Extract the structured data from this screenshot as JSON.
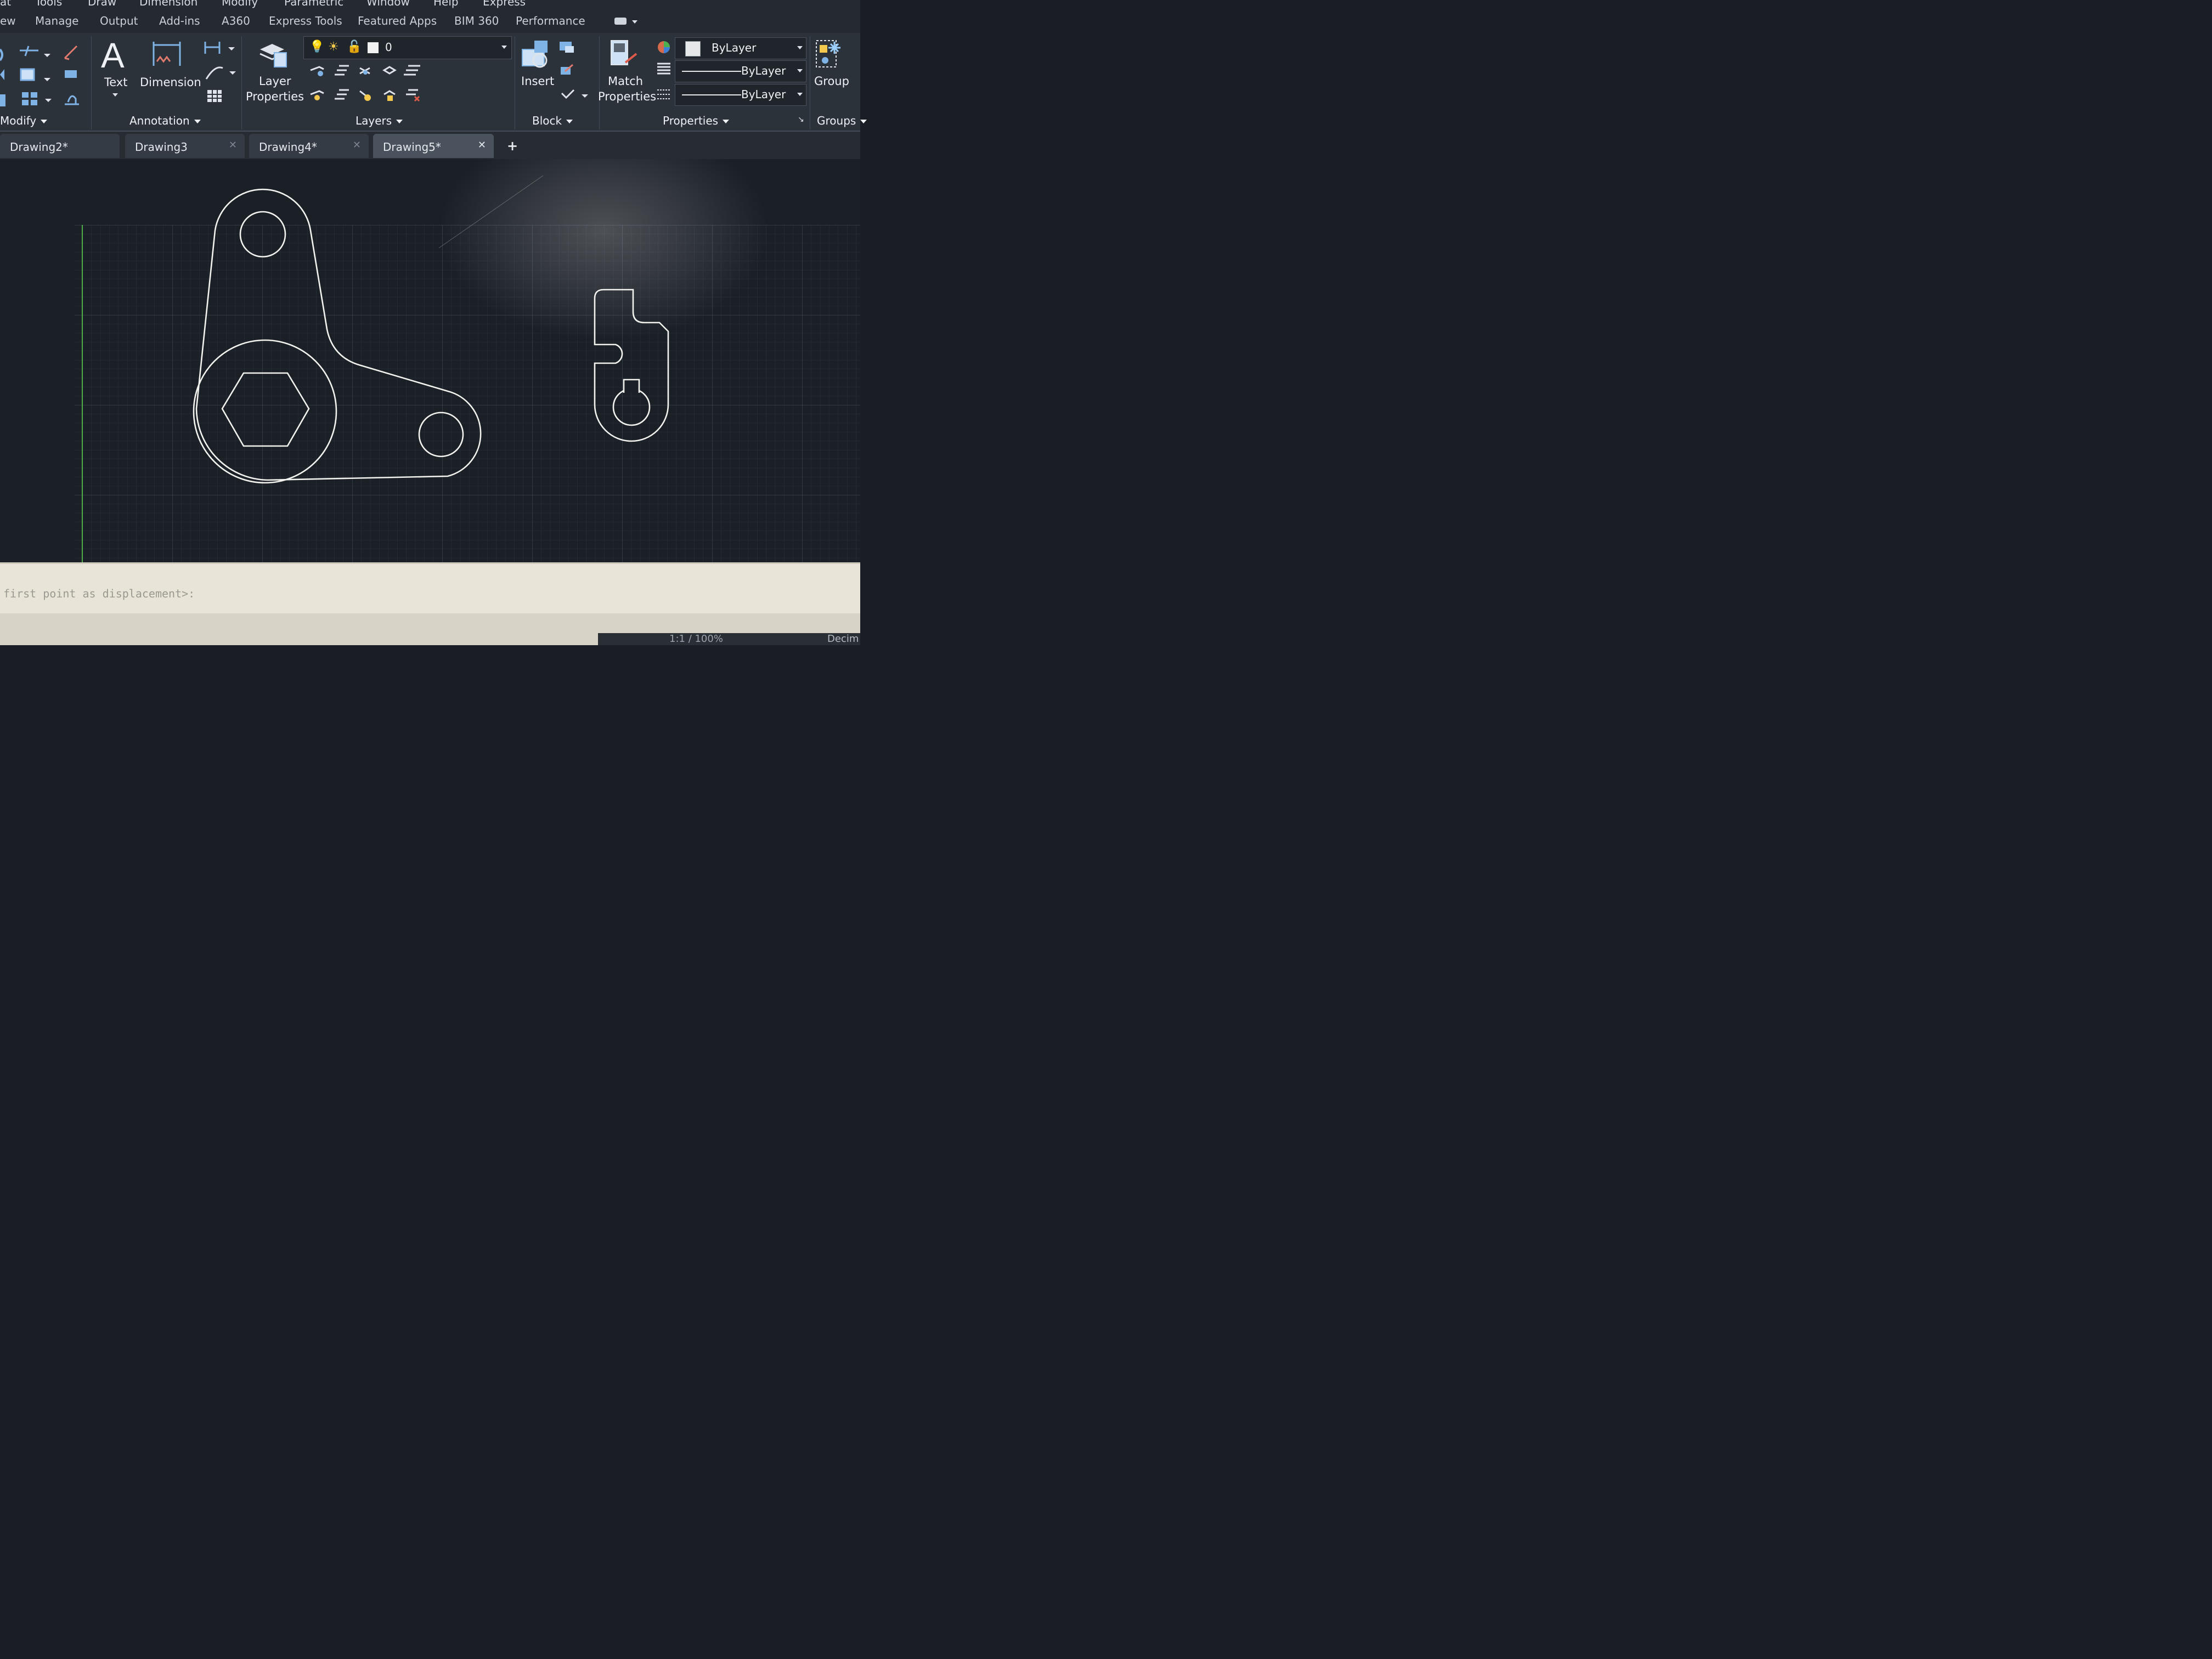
{
  "menu": [
    "at",
    "Tools",
    "Draw",
    "Dimension",
    "Modify",
    "Parametric",
    "Window",
    "Help",
    "Express"
  ],
  "ribbon_tabs": [
    "ew",
    "Manage",
    "Output",
    "Add-ins",
    "A360",
    "Express Tools",
    "Featured Apps",
    "BIM 360",
    "Performance"
  ],
  "panels": {
    "modify": "Modify",
    "annotation": "Annotation",
    "layers": "Layers",
    "block": "Block",
    "properties": "Properties",
    "groups": "Groups"
  },
  "buttons": {
    "text": "Text",
    "dimension": "Dimension",
    "layer_properties_1": "Layer",
    "layer_properties_2": "Properties",
    "insert": "Insert",
    "match_properties_1": "Match",
    "match_properties_2": "Properties",
    "group": "Group"
  },
  "layer_combo": {
    "value": "0"
  },
  "property_combos": {
    "color": "ByLayer",
    "linetype": "ByLayer",
    "lineweight": "ByLayer"
  },
  "doc_tabs": [
    {
      "label": "Drawing2*",
      "active": false
    },
    {
      "label": "Drawing3",
      "active": false
    },
    {
      "label": "Drawing4*",
      "active": false
    },
    {
      "label": "Drawing5*",
      "active": true
    }
  ],
  "new_tab": "+",
  "command_line": "first point as displacement>:",
  "status": {
    "scale": "1:1 / 100%",
    "units": "Decim"
  },
  "colors": {
    "ribbon_bg": "#2c323a",
    "canvas_bg": "#1b2027",
    "grid": "#3a4350",
    "geometry": "#f2f2ee",
    "ucs_y": "#4fae4a",
    "cmd_bg": "#e8e4d7"
  }
}
